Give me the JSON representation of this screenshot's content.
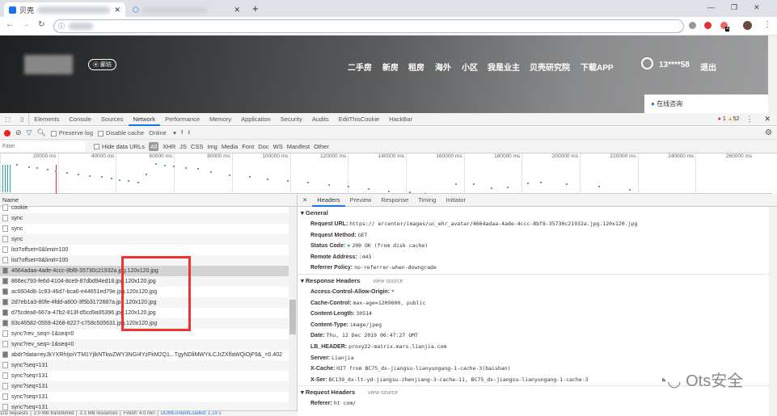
{
  "browser": {
    "tab1_title": "贝壳",
    "tab1_suffix": "…",
    "new_tab": "+",
    "ext_badge": "4",
    "window_controls": [
      "—",
      "❐",
      "✕"
    ]
  },
  "site": {
    "city": "廊坊",
    "nav": [
      "二手房",
      "新房",
      "租房",
      "海外",
      "小区",
      "我是业主",
      "贝壳研究院",
      "下载APP"
    ],
    "user": "13****58",
    "logout": "退出",
    "consult": "在线咨询"
  },
  "devtools": {
    "tabs": [
      "Elements",
      "Console",
      "Sources",
      "Network",
      "Performance",
      "Memory",
      "Application",
      "Security",
      "Audits",
      "EditThisCookie",
      "HackBar"
    ],
    "active_tab": "Network",
    "errors": "1",
    "warnings": "52",
    "toolbar": {
      "preserve_log": "Preserve log",
      "disable_cache": "Disable cache",
      "throttle": "Online"
    },
    "filter": {
      "placeholder": "Filter",
      "hide_data_urls": "Hide data URLs",
      "types": [
        "All",
        "XHR",
        "JS",
        "CSS",
        "Img",
        "Media",
        "Font",
        "Doc",
        "WS",
        "Manifest",
        "Other"
      ]
    },
    "timeline_ticks": [
      "20000 ms",
      "40000 ms",
      "60000 ms",
      "80000 ms",
      "100000 ms",
      "120000 ms",
      "140000 ms",
      "160000 ms",
      "180000 ms",
      "200000 ms",
      "220000 ms",
      "240000 ms",
      "260000 ms"
    ],
    "name_header": "Name",
    "requests": [
      {
        "name": "cookie",
        "img": false
      },
      {
        "name": "sync",
        "img": false
      },
      {
        "name": "sync",
        "img": false
      },
      {
        "name": "sync",
        "img": false
      },
      {
        "name": "list?offset=0&limit=100",
        "img": false
      },
      {
        "name": "list?offset=0&limit=100",
        "img": false
      },
      {
        "name": "4664adaa-4ade-4ccc-8bf8-35730c21932a.jpg.120x120.jpg",
        "img": true,
        "selected": true
      },
      {
        "name": "866ec793-fe6d-4104-8ce9-87dbd94ed18.jpg.120x120.jpg",
        "img": true
      },
      {
        "name": "ac6604d8-1c93-46d7-bca6-e44651ed79e.jpg.120x120.jpg",
        "img": true
      },
      {
        "name": "2d7eb1a3-80fe-4fdd-a600-3f5b3172687a.jpg.120x120.jpg",
        "img": true
      },
      {
        "name": "d75cdea8-667a-47b2-813f-d5cd9a95396.jpg.120x120.jpg",
        "img": true
      },
      {
        "name": "83c46582-0559-4268-8227-c758c505631.jpg.120x120.jpg",
        "img": true
      },
      {
        "name": "sync?rev_seq=-1&seq=0",
        "img": false
      },
      {
        "name": "sync?rev_seq=-1&seq=0",
        "img": false
      },
      {
        "name": "abdr?data=eyJkYXRhIjoiYTM1YjlkNTkwZWY3NGI4YzFkM2Q1...TgyNDliMWYiLCJrZXlfaWQiOjF9&_=0.402",
        "img": true
      },
      {
        "name": "sync?seq=131",
        "img": false
      },
      {
        "name": "sync?seq=131",
        "img": false
      },
      {
        "name": "sync?seq=131",
        "img": false
      },
      {
        "name": "sync?seq=131",
        "img": false
      },
      {
        "name": "sync?seq=131",
        "img": false
      }
    ],
    "status_bar": [
      "102 requests",
      "2.0 MB transferred",
      "2.1 MB resources",
      "Finish: 4.0 min",
      "DOMContentLoaded: 1.19 s"
    ],
    "detail_tabs": [
      "Headers",
      "Preview",
      "Response",
      "Timing",
      "Initiator"
    ],
    "general_title": "General",
    "general": [
      {
        "k": "Request URL:",
        "v": "https://                    ercenter/images/uc_ehr_avatar/4664adaa-4ade-4ccc-8bf8-35730c21932a.jpg.120x120.jpg"
      },
      {
        "k": "Request Method:",
        "v": "GET"
      },
      {
        "k": "Status Code:",
        "v": "200 OK (from disk cache)"
      },
      {
        "k": "Remote Address:",
        "v": "              :443"
      },
      {
        "k": "Referrer Policy:",
        "v": "no-referrer-when-downgrade"
      }
    ],
    "response_title": "Response Headers",
    "view_source": "view source",
    "response": [
      {
        "k": "Access-Control-Allow-Origin:",
        "v": "*"
      },
      {
        "k": "Cache-Control:",
        "v": "max-age=1209600, public"
      },
      {
        "k": "Content-Length:",
        "v": "30514"
      },
      {
        "k": "Content-Type:",
        "v": "image/jpeg"
      },
      {
        "k": "Date:",
        "v": "Thu, 12 Dec 2019 06:47:27 GMT"
      },
      {
        "k": "LB_HEADER:",
        "v": "proxy22-matrix.mars.lianjia.com"
      },
      {
        "k": "Server:",
        "v": "Lianjia"
      },
      {
        "k": "X-Cache:",
        "v": "HIT from BC75_dx-jiangsu-lianyungang-1-cache-3(baishan)"
      },
      {
        "k": "X-Ser:",
        "v": "BC139_dx-lt-yd-jiangsu-zhenjiang-3-cache-11, BC75_dx-jiangsu-lianyungang-1-cache-3"
      }
    ],
    "request_title": "Request Headers",
    "request": [
      {
        "k": "Referer:",
        "v": "ht          com/"
      }
    ]
  },
  "watermark": "Ots安全"
}
